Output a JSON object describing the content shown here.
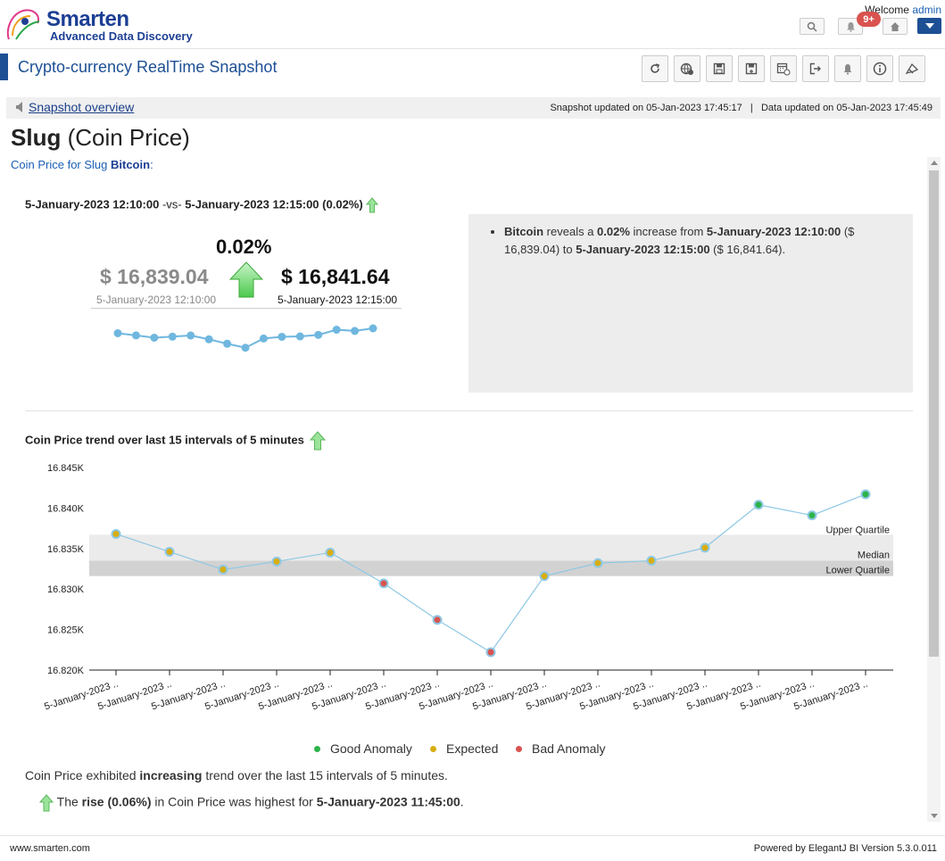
{
  "brand": {
    "name": "Smarten",
    "tagline": "Advanced Data Discovery"
  },
  "header": {
    "welcome": "Welcome",
    "user": "admin",
    "notification_badge": "9+"
  },
  "page": {
    "title": "Crypto-currency RealTime Snapshot"
  },
  "toolbar_icons": [
    "refresh-icon",
    "web-icon",
    "save-icon",
    "save-as-icon",
    "schedule-icon",
    "exit-icon",
    "alert-icon",
    "info-icon",
    "settings-icon"
  ],
  "breadcrumb": {
    "label": "Snapshot overview",
    "updated_text": "Snapshot updated on 05-Jan-2023 17:45:17   |   Data updated on 05-Jan-2023 17:45:49"
  },
  "heading": {
    "main": "Slug",
    "paren": " (Coin Price)"
  },
  "subheading": {
    "prefix": "Coin Price for Slug ",
    "entity": "Bitcoin",
    "suffix": ":"
  },
  "comparison": {
    "from_date": "5-January-2023 12:10:00",
    "vs": " -vs- ",
    "to_date": "5-January-2023 12:15:00",
    "change": "(0.02%)",
    "pct": "0.02%",
    "from_value": "$ 16,839.04",
    "to_value": "$ 16,841.64",
    "from_label": "5-January-2023 12:10:00",
    "to_label": "5-January-2023 12:15:00"
  },
  "insight": {
    "entity": "Bitcoin",
    "t1": " reveals a ",
    "pct": "0.02%",
    "t2": " increase from ",
    "from_date": "5-January-2023 12:10:00",
    "t3": " ($ 16,839.04) to ",
    "to_date": "5-January-2023 12:15:00",
    "t4": " ($ 16,841.64)."
  },
  "sparkline_values": [
    16836.8,
    16834.6,
    16832.3,
    16833.4,
    16834.5,
    16830.7,
    16826.2,
    16822.2,
    16831.5,
    16833.2,
    16833.6,
    16835.1,
    16840.3,
    16839.1,
    16841.7
  ],
  "trend": {
    "title": "Coin Price trend over last 15 intervals of 5 minutes"
  },
  "chart_data": {
    "type": "line",
    "ylim": [
      16820,
      16845
    ],
    "yticks": [
      "16.820K",
      "16.825K",
      "16.830K",
      "16.835K",
      "16.840K",
      "16.845K"
    ],
    "x": [
      "5-January-2023 ..",
      "5-January-2023 ..",
      "5-January-2023 ..",
      "5-January-2023 ..",
      "5-January-2023 ..",
      "5-January-2023 ..",
      "5-January-2023 ..",
      "5-January-2023 ..",
      "5-January-2023 ..",
      "5-January-2023 ..",
      "5-January-2023 ..",
      "5-January-2023 ..",
      "5-January-2023 ..",
      "5-January-2023 ..",
      "5-January-2023 .."
    ],
    "series": [
      {
        "values": [
          16836.8,
          16834.6,
          16832.4,
          16833.4,
          16834.5,
          16830.7,
          16826.2,
          16822.2,
          16831.6,
          16833.2,
          16833.5,
          16835.1,
          16840.4,
          16839.1,
          16841.7
        ]
      }
    ],
    "point_status": [
      "expected",
      "expected",
      "expected",
      "expected",
      "expected",
      "bad",
      "bad",
      "bad",
      "expected",
      "expected",
      "expected",
      "expected",
      "good",
      "good",
      "good"
    ],
    "bands": {
      "upper_quartile": 16836.7,
      "median": 16833.5,
      "lower_quartile": 16831.6
    },
    "band_labels": {
      "upper": "Upper Quartile",
      "median": "Median",
      "lower": "Lower Quartile"
    },
    "line_color": "#8ec8e4",
    "status_colors": {
      "good": "#2db34a",
      "expected": "#d8ad10",
      "bad": "#d9534f"
    },
    "legend": [
      {
        "label": "Good Anomaly",
        "color": "#2db34a"
      },
      {
        "label": "Expected",
        "color": "#d8ad10"
      },
      {
        "label": "Bad Anomaly",
        "color": "#d9534f"
      }
    ]
  },
  "summary": {
    "prefix": "Coin Price exhibited ",
    "bold": "increasing",
    "suffix": " trend over the last 15 intervals of 5 minutes."
  },
  "rise": {
    "prefix": "The ",
    "bold1": "rise (0.06%)",
    "mid": " in Coin Price was highest for ",
    "bold2": "5-January-2023 11:45:00",
    "suffix": "."
  },
  "footer": {
    "left": "www.smarten.com",
    "right": "Powered by ElegantJ BI Version 5.3.0.011"
  }
}
